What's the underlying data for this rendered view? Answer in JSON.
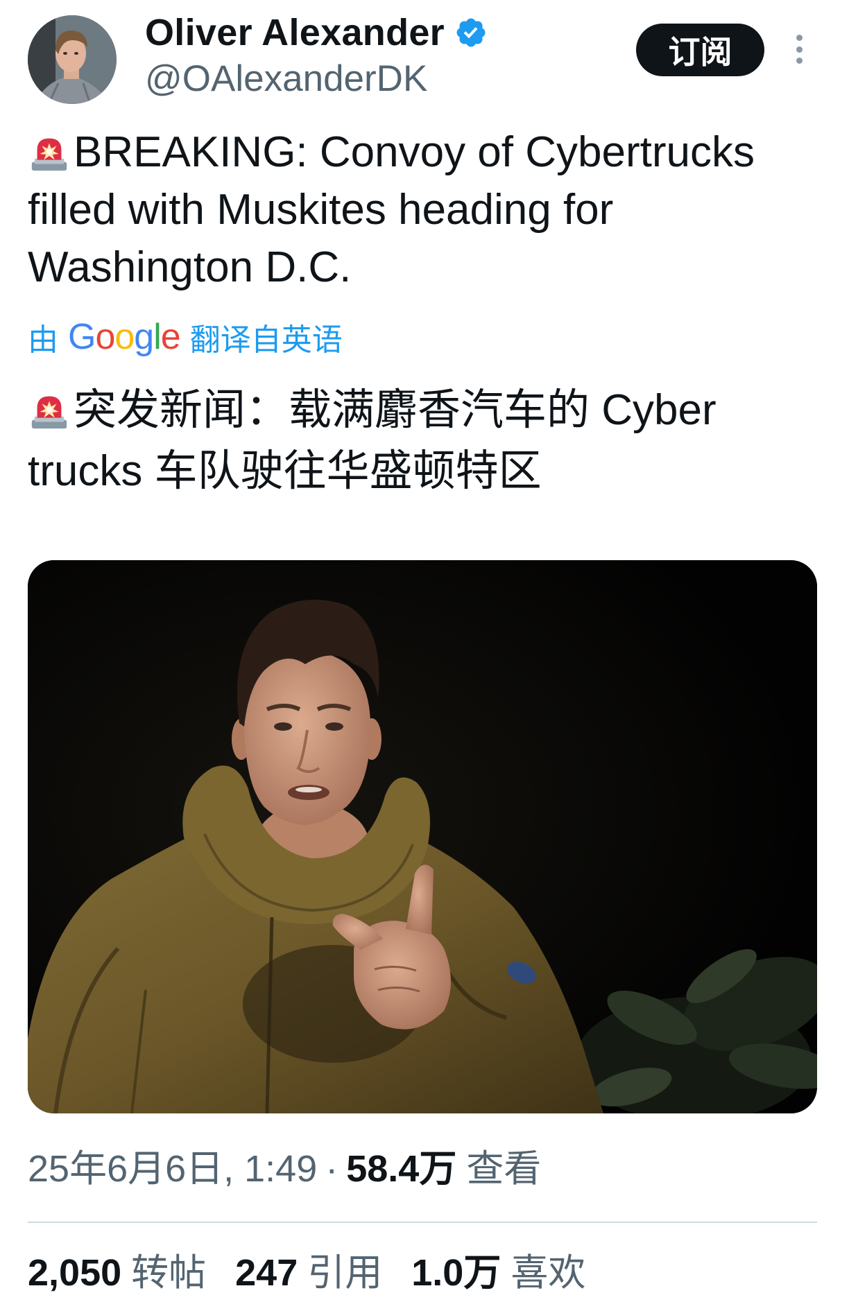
{
  "author": {
    "name": "Oliver Alexander",
    "handle": "@OAlexanderDK",
    "verified": true,
    "avatar_icon": "avatar",
    "badge_icon": "verified-badge-icon"
  },
  "header": {
    "subscribe_label": "订阅",
    "more_icon": "more-vertical-icon"
  },
  "tweet": {
    "icon": "siren-icon",
    "text_lines": [
      "BREAKING: Convoy of Cybertrucks",
      "filled with Muskites heading for",
      "Washington D.C."
    ]
  },
  "translation": {
    "prefix": "由",
    "provider": "Google",
    "provider_colors": [
      "#4285F4",
      "#EA4335",
      "#FBBC05",
      "#4285F4",
      "#34A853",
      "#EA4335"
    ],
    "suffix": "翻译自英语"
  },
  "translated": {
    "icon": "siren-icon",
    "text_lines": [
      "突发新闻：载满麝香汽车的 Cyber",
      "trucks 车队驶往华盛顿特区"
    ]
  },
  "meta": {
    "date": "25年6月6日, 1:49",
    "separator": "·",
    "views_count": "58.4万",
    "views_label": "查看"
  },
  "stats": [
    {
      "count": "2,050",
      "label": "转帖"
    },
    {
      "count": "247",
      "label": "引用"
    },
    {
      "count": "1.0万",
      "label": "喜欢"
    }
  ],
  "colors": {
    "text": "#0f1419",
    "secondary": "#536471",
    "link": "#1d9bf0",
    "verified": "#1d9bf0",
    "button": "#0f1419",
    "divider": "#cfd9de"
  }
}
